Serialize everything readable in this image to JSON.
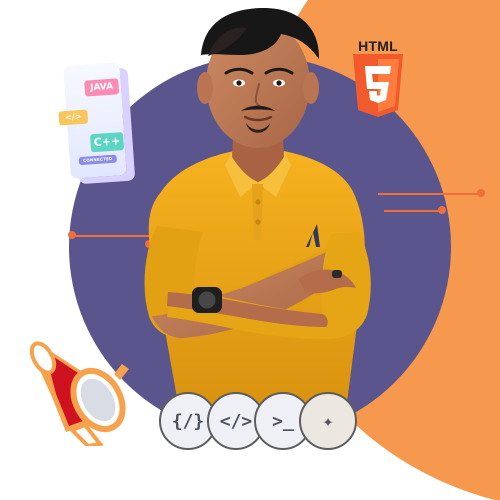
{
  "scene": {
    "colors": {
      "background": "#ffffff",
      "orange": "#f6984d",
      "purple": "#5a558d",
      "accent": "#ef6f3b"
    }
  },
  "phone_card": {
    "chips": {
      "java": "JAVA",
      "code": "</>",
      "cpp": "C++",
      "connected": "CONNECTED"
    }
  },
  "html_badge": {
    "label": "HTML",
    "number": "5"
  },
  "code_badges": [
    {
      "symbol": "{/}"
    },
    {
      "symbol": "</>"
    },
    {
      "symbol": ">_"
    },
    {
      "symbol": "✦"
    }
  ]
}
